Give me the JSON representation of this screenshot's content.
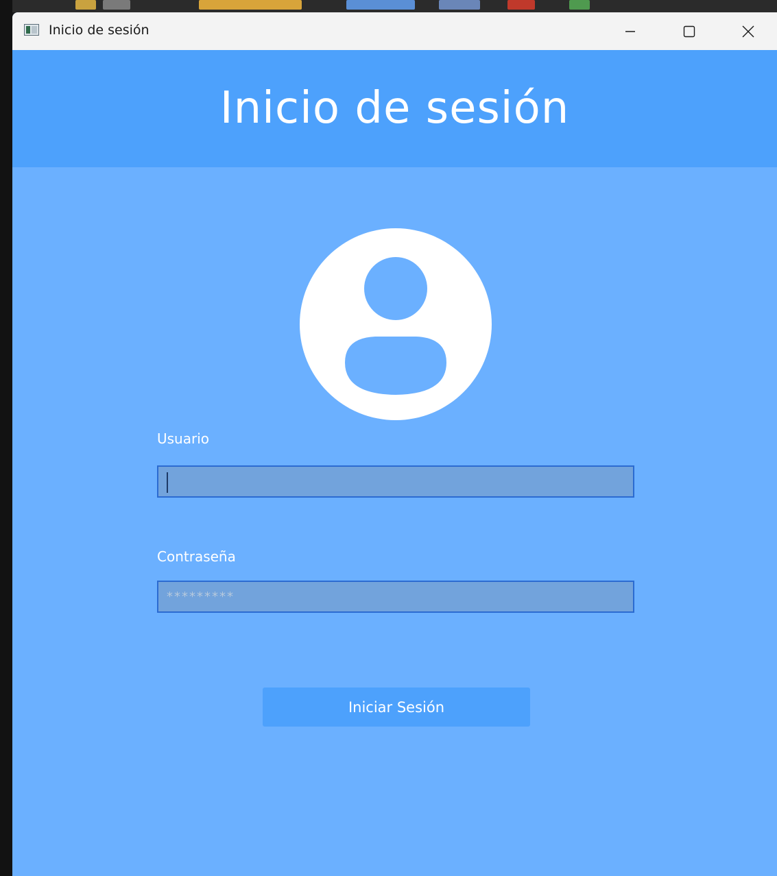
{
  "window": {
    "title": "Inicio de sesión",
    "controls": {
      "minimize": "—",
      "maximize": "☐",
      "close": "✕"
    }
  },
  "header": {
    "title": "Inicio de sesión"
  },
  "avatar": {
    "icon": "user-avatar-icon"
  },
  "form": {
    "username_label": "Usuario",
    "username_value": "",
    "password_label": "Contraseña",
    "password_placeholder": "*********",
    "submit_label": "Iniciar Sesión"
  },
  "colors": {
    "header_bg": "#4da1fc",
    "body_bg": "#6bb0ff",
    "field_bg": "#72a3dc",
    "field_border": "#2b6bd1",
    "button_bg": "#4da1fc"
  }
}
